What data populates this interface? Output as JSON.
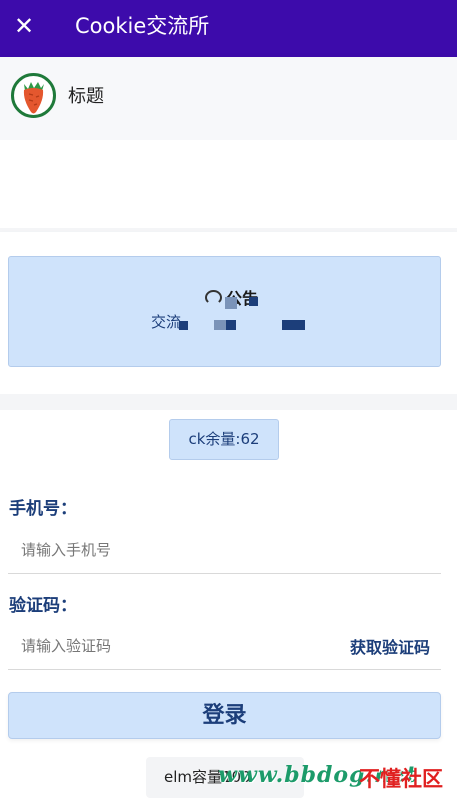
{
  "appbar": {
    "close_glyph": "✕",
    "title": "Cookie交流所"
  },
  "header": {
    "title": "标题"
  },
  "notice": {
    "title": "公告",
    "body_visible": "交流"
  },
  "ck": {
    "remaining_label": "ck余量:62"
  },
  "form": {
    "phone_label": "手机号：",
    "phone_placeholder": "请输入手机号",
    "code_label": "验证码：",
    "code_placeholder": "请输入验证码",
    "get_code_label": "获取验证码",
    "login_label": "登录"
  },
  "footer": {
    "chip_text": "elm容量100"
  },
  "watermark": {
    "site": "www.bbdog.net",
    "community": "不懂社区"
  },
  "colors": {
    "appbar": "#3d0bab",
    "accent_text": "#1c3e7a",
    "panel_fill": "#cfe3fb",
    "logo_ring": "#1f7a3a"
  },
  "icons": {
    "close": "close-icon",
    "logo": "carrot-logo-icon",
    "notice": "notice-icon"
  }
}
